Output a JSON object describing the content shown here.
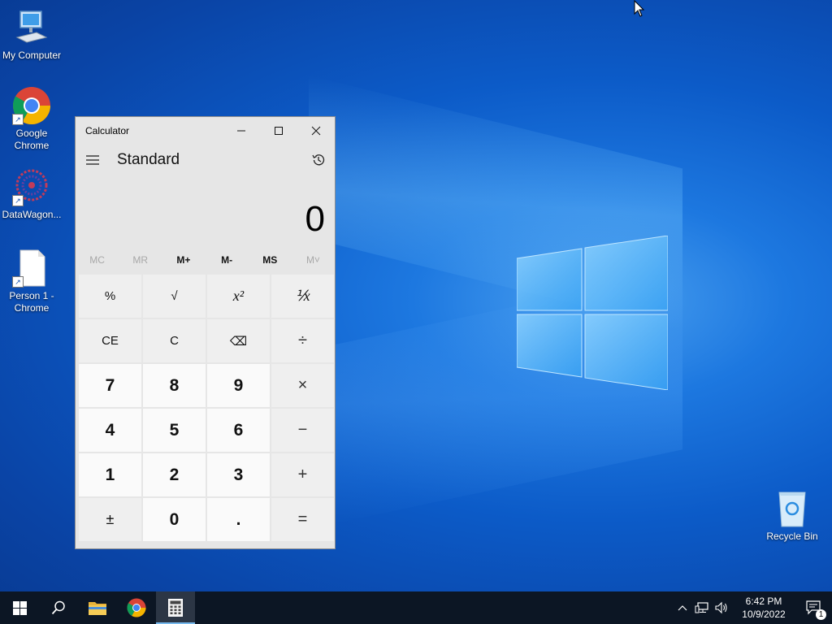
{
  "desktop": {
    "icons": [
      {
        "label": "My Computer"
      },
      {
        "label": "Google Chrome"
      },
      {
        "label": "DataWagon..."
      },
      {
        "label": "Person 1 - Chrome"
      },
      {
        "label": "Recycle Bin"
      }
    ]
  },
  "calculator": {
    "window_title": "Calculator",
    "mode": "Standard",
    "display_value": "0",
    "memory_buttons": [
      {
        "label": "MC",
        "enabled": false
      },
      {
        "label": "MR",
        "enabled": false
      },
      {
        "label": "M+",
        "enabled": true
      },
      {
        "label": "M-",
        "enabled": true
      },
      {
        "label": "MS",
        "enabled": true
      },
      {
        "label": "M˅",
        "enabled": false
      }
    ],
    "keys": {
      "percent": "%",
      "sqrt": "√",
      "square": "x²",
      "reciprocal": "⅟x",
      "ce": "CE",
      "c": "C",
      "backspace": "⌫",
      "divide": "÷",
      "seven": "7",
      "eight": "8",
      "nine": "9",
      "multiply": "×",
      "four": "4",
      "five": "5",
      "six": "6",
      "minus": "−",
      "one": "1",
      "two": "2",
      "three": "3",
      "plus": "+",
      "negate": "±",
      "zero": "0",
      "decimal": ".",
      "equals": "="
    }
  },
  "taskbar": {
    "clock_time": "6:42 PM",
    "clock_date": "10/9/2022",
    "notification_count": "1"
  },
  "colors": {
    "desktop_blue": "#0c5bc8",
    "taskbar": "#0c1624",
    "accent": "#76b9ed"
  }
}
